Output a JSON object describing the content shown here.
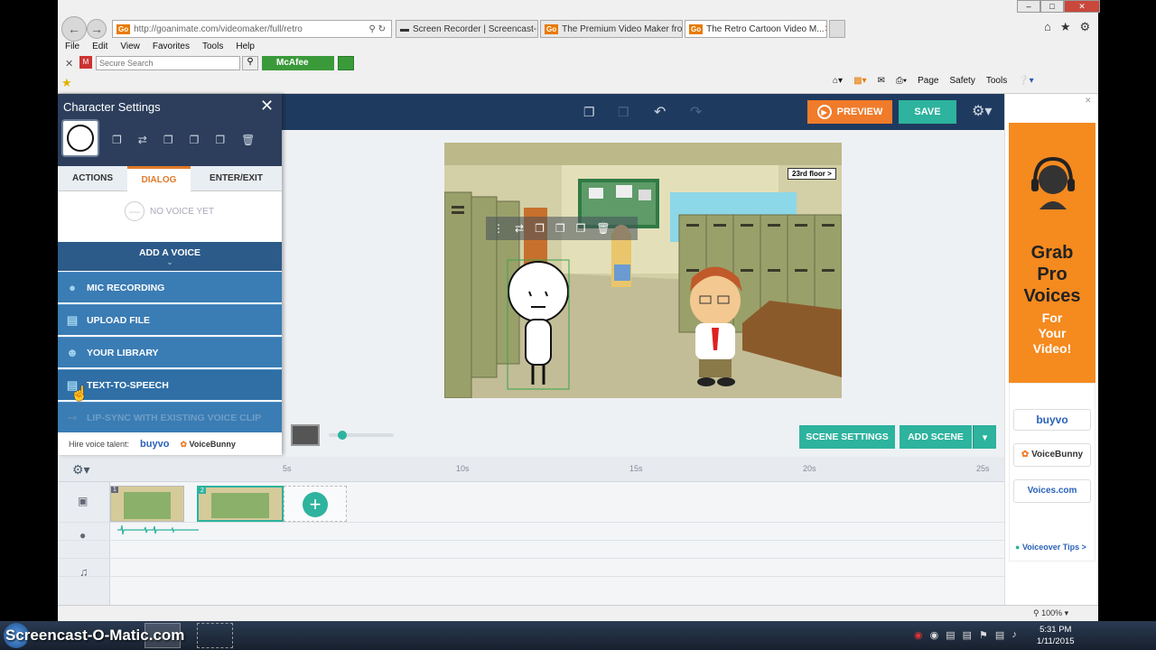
{
  "browser": {
    "url": "http://goanimate.com/videomaker/full/retro",
    "tabs": [
      {
        "label": "Screen Recorder | Screencast-..."
      },
      {
        "label": "The Premium Video Maker fro..."
      },
      {
        "label": "The Retro Cartoon Video M..."
      }
    ],
    "menu": [
      "File",
      "Edit",
      "View",
      "Favorites",
      "Tools",
      "Help"
    ],
    "search_placeholder": "Secure Search",
    "mcafee_label": "McAfee",
    "command_bar": [
      "Page",
      "Safety",
      "Tools"
    ],
    "zoom": "100%"
  },
  "app": {
    "preview_label": "PREVIEW",
    "save_label": "SAVE",
    "scene_settings_label": "SCENE SETTINGS",
    "add_scene_label": "ADD SCENE",
    "stage_sign": "23rd floor >"
  },
  "panel": {
    "title": "Character Settings",
    "tabs": [
      "ACTIONS",
      "DIALOG",
      "ENTER/EXIT"
    ],
    "no_voice": "NO VOICE YET",
    "add_voice": "ADD A VOICE",
    "options": [
      "MIC RECORDING",
      "UPLOAD FILE",
      "YOUR LIBRARY",
      "TEXT-TO-SPEECH",
      "LIP-SYNC WITH EXISTING VOICE CLIP"
    ],
    "hire_label": "Hire voice talent:",
    "buyvo": "buyvo",
    "voicebunny": "VoiceBunny"
  },
  "timeline": {
    "ticks": [
      "5s",
      "10s",
      "15s",
      "20s",
      "25s"
    ],
    "scene_numbers": [
      "1",
      "2"
    ]
  },
  "ad": {
    "headline": [
      "Grab",
      "Pro",
      "Voices"
    ],
    "sub": [
      "For",
      "Your",
      "Video!"
    ],
    "brands": [
      "buyvo",
      "VoiceBunny",
      "Voices.com"
    ],
    "tips": "Voiceover Tips >"
  },
  "taskbar": {
    "watermark": "Screencast-O-Matic.com",
    "time": "5:31 PM",
    "date": "1/11/2015"
  },
  "colors": {
    "accent_green": "#2db39e",
    "accent_orange": "#f07b2a",
    "panel_blue": "#3a7cb4",
    "navy": "#1f3a5f"
  }
}
